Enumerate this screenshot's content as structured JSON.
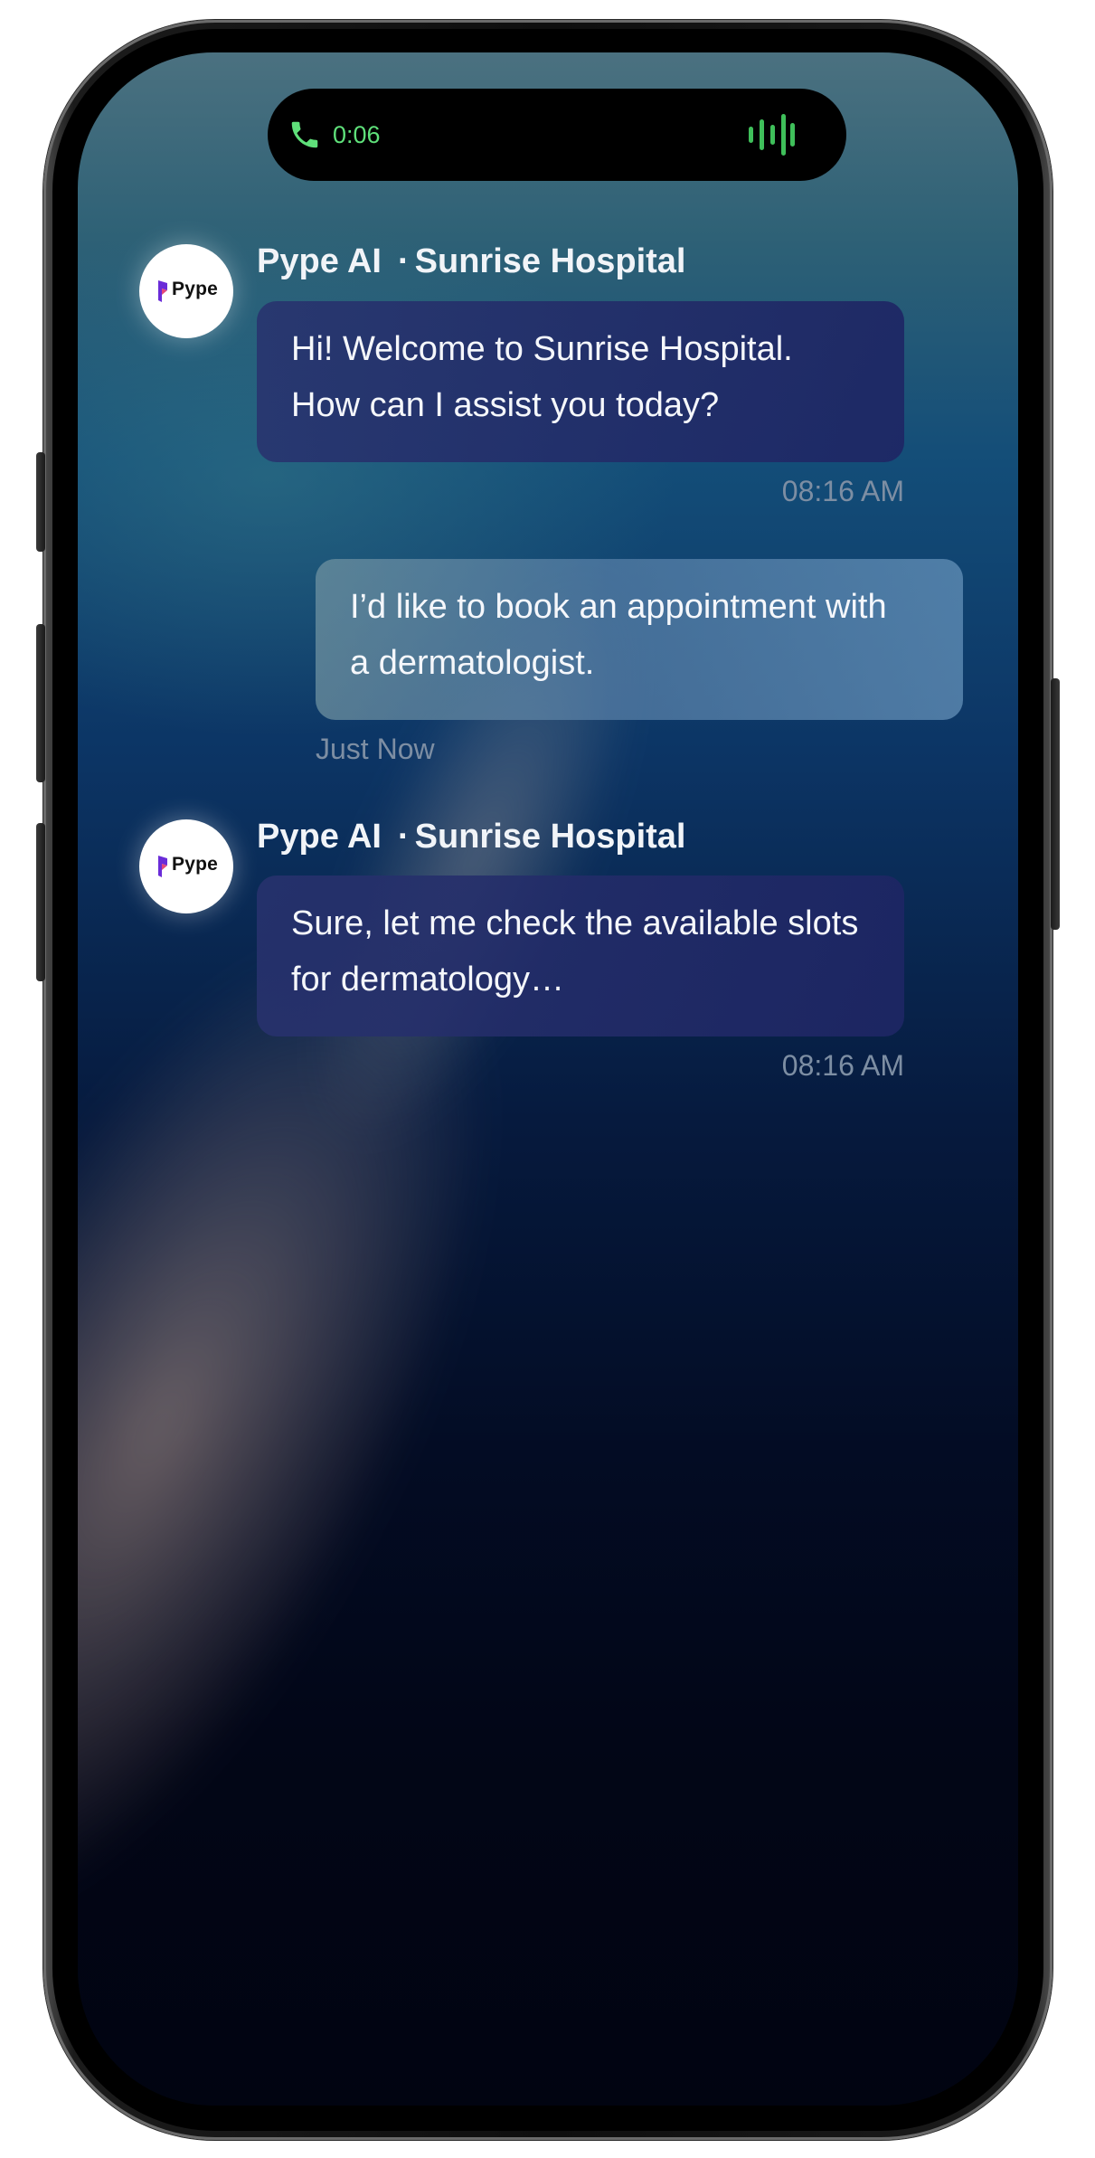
{
  "status_bar": {
    "call_timer": "0:06",
    "call_icon": "phone-icon",
    "waveform_icon": "audio-waveform-icon",
    "accent_color": "#5fe07a"
  },
  "avatar": {
    "logo_text": "Pype"
  },
  "messages": [
    {
      "role": "assistant",
      "sender_name": "Pype AI",
      "separator": "·",
      "organization": "Sunrise Hospital",
      "text_lines": [
        "Hi! Welcome to Sunrise Hospital.",
        "How can I assist you today?"
      ],
      "time": "08:16 AM"
    },
    {
      "role": "user",
      "text_lines": [
        "I’d like to book an appointment with",
        "a dermatologist."
      ],
      "time": "Just Now"
    },
    {
      "role": "assistant",
      "sender_name": "Pype AI",
      "separator": "·",
      "organization": "Sunrise Hospital",
      "text_lines": [
        "Sure, let me check the available slots",
        "for dermatology…"
      ],
      "time": "08:16 AM"
    }
  ],
  "colors": {
    "assistant_bubble": "#28326e",
    "user_bubble": "#6e91a0",
    "timestamp": "#7d8ea3"
  }
}
